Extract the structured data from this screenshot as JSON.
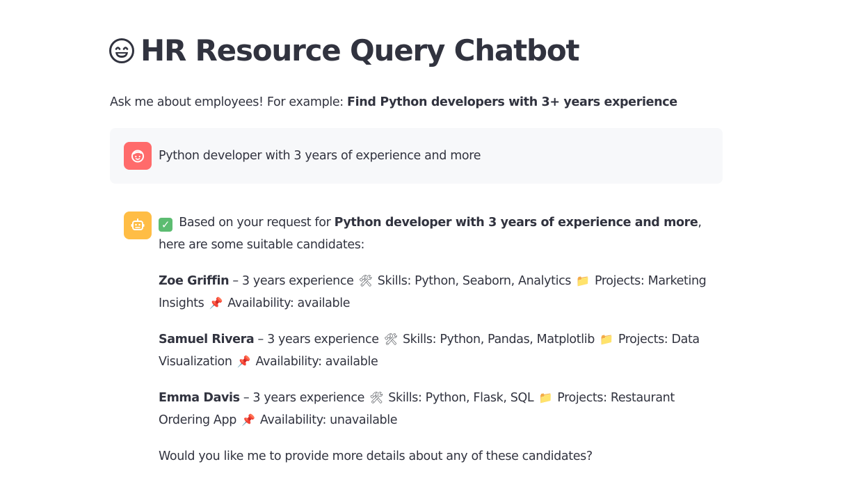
{
  "header": {
    "title": "HR Resource Query Chatbot",
    "icon": "grinning-face-icon"
  },
  "intro": {
    "text": "Ask me about employees! For example: ",
    "example": "Find Python developers with 3+ years experience"
  },
  "chat": {
    "user_message": "Python developer with 3 years of experience and more",
    "bot": {
      "intro_prefix": "Based on your request for ",
      "intro_query": "Python developer with 3 years of experience and more",
      "intro_suffix": ", here are some suitable candidates:",
      "candidates": [
        {
          "name": "Zoe Griffin",
          "experience": " – 3 years experience ",
          "skills": " Skills: Python, Seaborn, Analytics ",
          "projects": " Projects: Marketing Insights ",
          "availability": " Availability: available"
        },
        {
          "name": "Samuel Rivera",
          "experience": " – 3 years experience ",
          "skills": " Skills: Python, Pandas, Matplotlib ",
          "projects": " Projects: Data Visualization ",
          "availability": " Availability: available"
        },
        {
          "name": "Emma Davis",
          "experience": " – 3 years experience ",
          "skills": " Skills: Python, Flask, SQL ",
          "projects": " Projects: Restaurant Ordering App ",
          "availability": " Availability: unavailable"
        }
      ],
      "closing": "Would you like me to provide more details about any of these candidates?"
    }
  },
  "colors": {
    "user_avatar": "#ff6b6b",
    "bot_avatar": "#ffbd45",
    "text": "#31333f",
    "user_bubble": "#f7f8fa",
    "check": "#5cbc71"
  }
}
